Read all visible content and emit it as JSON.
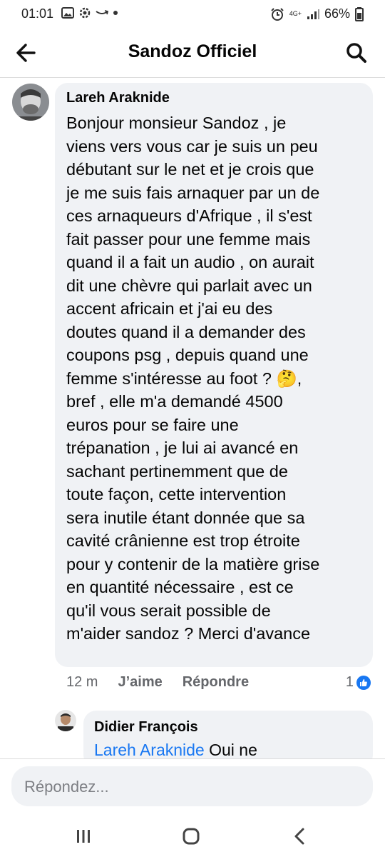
{
  "status_bar": {
    "time": "01:01",
    "network": "4G+",
    "battery": "66%",
    "icons": [
      "gallery-icon",
      "settings-icon",
      "amazon-icon",
      "dot-icon",
      "alarm-icon",
      "signal-icon",
      "battery-icon"
    ]
  },
  "header": {
    "title": "Sandoz Officiel",
    "back_icon": "arrow-left-icon",
    "search_icon": "search-icon"
  },
  "comments": [
    {
      "author": "Lareh Araknide",
      "text": "Bonjour monsieur Sandoz , je\nviens vers vous car je suis un peu\ndébutant sur le net et je crois que\nje me suis fais arnaquer par un de\nces arnaqueurs d'Afrique , il s'est\nfait passer pour une femme mais\nquand il a fait un audio , on aurait\ndit une chèvre qui parlait avec un\naccent africain et j'ai eu des\ndoutes quand il a demander des\ncoupons psg , depuis quand une\nfemme s'intéresse au foot ? 🤔,\nbref , elle m'a demandé 4500\neuros pour se faire une\ntrépanation , je lui ai avancé en\nsachant pertinemment que de\ntoute façon,  cette intervention\nsera inutile étant donnée que sa\ncavité crânienne est trop étroite\npour y contenir de la matière grise\nen quantité nécessaire , est ce\nqu'il vous serait possible de\nm'aider sandoz ? Merci d'avance",
      "time": "12 m",
      "like_label": "J’aime",
      "reply_label": "Répondre",
      "reaction_count": "1",
      "reaction_icon": "thumbs-up-icon"
    },
    {
      "author": "Didier François",
      "mention": "Lareh Araknide",
      "text": " Oui ne"
    }
  ],
  "composer": {
    "placeholder": "Répondez..."
  },
  "nav": {
    "icons": [
      "recent-apps-icon",
      "home-icon",
      "back-icon"
    ]
  },
  "colors": {
    "bubble": "#f0f2f5",
    "link": "#1877f2",
    "secondary_text": "#65676b"
  }
}
